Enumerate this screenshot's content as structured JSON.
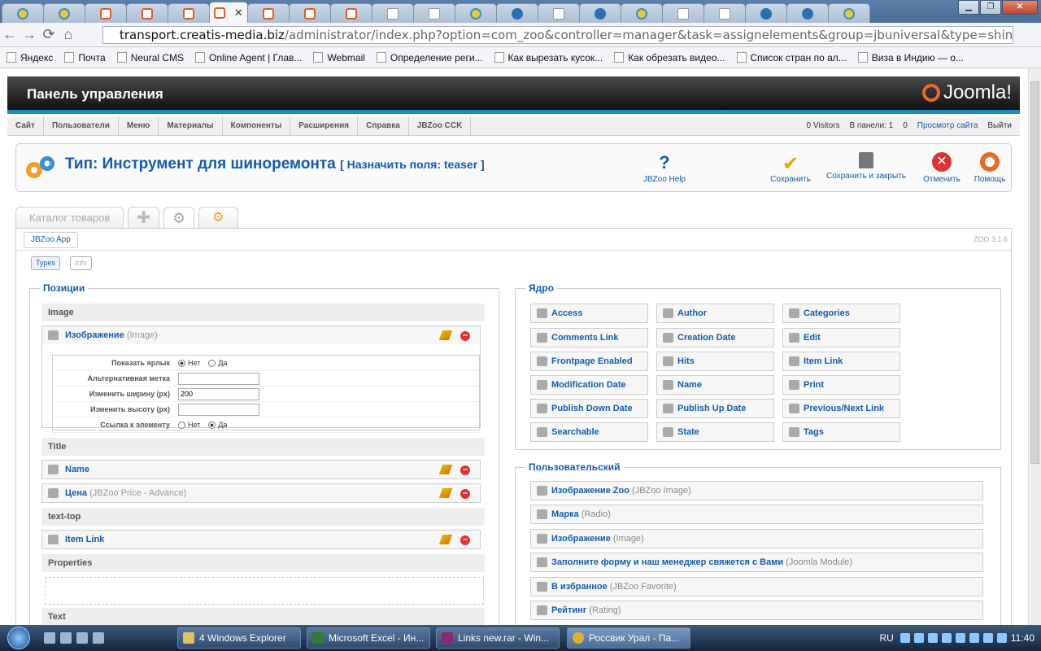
{
  "browser": {
    "url_host": "transport.creatis-media.biz",
    "url_path": "/administrator/index.php?option=com_zoo&controller=manager&task=assignelements&group=jbuniversal&type=shino-cc",
    "bookmarks": [
      "Яндекс",
      "Почта",
      "Neural CMS",
      "Online Agent | Глав...",
      "Webmail",
      "Определение реги...",
      "Как вырезать кусок...",
      "Как обрезать видео...",
      "Список стран по ал...",
      "Виза в Индию — о..."
    ]
  },
  "header": {
    "title": "Панель управления",
    "logo": "Joomla!"
  },
  "menu": [
    "Сайт",
    "Пользователи",
    "Меню",
    "Материалы",
    "Компоненты",
    "Расширения",
    "Справка",
    "JBZoo CCK"
  ],
  "status": {
    "visitors": "0 Visitors",
    "in_panel": "В панели: 1",
    "messages": "0",
    "view_site": "Просмотр сайта",
    "logout": "Выйти"
  },
  "toolbar": {
    "title": "Тип: Инструмент для шиноремонта",
    "subtitle": "[ Назначить поля: teaser ]",
    "help": "JBZoo Help",
    "save": "Сохранить",
    "save_close": "Сохранить и закрыть",
    "cancel": "Отменить",
    "assist": "Помощь"
  },
  "tabs": {
    "catalog": "Каталог товаров"
  },
  "subtab": "JBZoo App",
  "version": "ZOO 3.1.6",
  "pills": {
    "types": "Types",
    "info": "Info"
  },
  "positions": {
    "legend": "Позиции",
    "image_sec": "Image",
    "image_el": {
      "name": "Изображение",
      "type": "(Image)"
    },
    "form": {
      "show_label": "Показать ярлык",
      "alt": "Альтернативная метка",
      "width": "Изменить ширину (px)",
      "width_val": "200",
      "height": "Изменить высоту (px)",
      "link": "Ссылка к элементу",
      "no": "Нет",
      "yes": "Да"
    },
    "title_sec": "Title",
    "name_el": "Name",
    "price_el": {
      "name": "Цена",
      "type": "(JBZoo Price - Advance)"
    },
    "texttop_sec": "text-top",
    "itemlink_el": "Item Link",
    "props_sec": "Properties",
    "text_sec": "Text"
  },
  "core": {
    "legend": "Ядро",
    "items": [
      "Access",
      "Author",
      "Categories",
      "Comments Link",
      "Creation Date",
      "Edit",
      "Frontpage Enabled",
      "Hits",
      "Item Link",
      "Modification Date",
      "Name",
      "Print",
      "Publish Down Date",
      "Publish Up Date",
      "Previous/Next Link",
      "Searchable",
      "State",
      "Tags"
    ]
  },
  "custom": {
    "legend": "Пользовательский",
    "items": [
      {
        "name": "Изображение Zoo",
        "type": "(JBZoo Image)"
      },
      {
        "name": "Марка",
        "type": "(Radio)"
      },
      {
        "name": "Изображение",
        "type": "(Image)"
      },
      {
        "name": "Заполните форму и наш менеджер свяжется с Вами",
        "type": "(Joomla Module)"
      },
      {
        "name": "В избранное",
        "type": "(JBZoo Favorite)"
      },
      {
        "name": "Рейтинг",
        "type": "(Rating)"
      }
    ]
  },
  "taskbar": {
    "buttons": [
      "4 Windows Explorer",
      "Microsoft Excel - Ин...",
      "Links new.rar - Win...",
      "Россвик Урал - Па..."
    ],
    "lang": "RU",
    "time": "11:40"
  }
}
